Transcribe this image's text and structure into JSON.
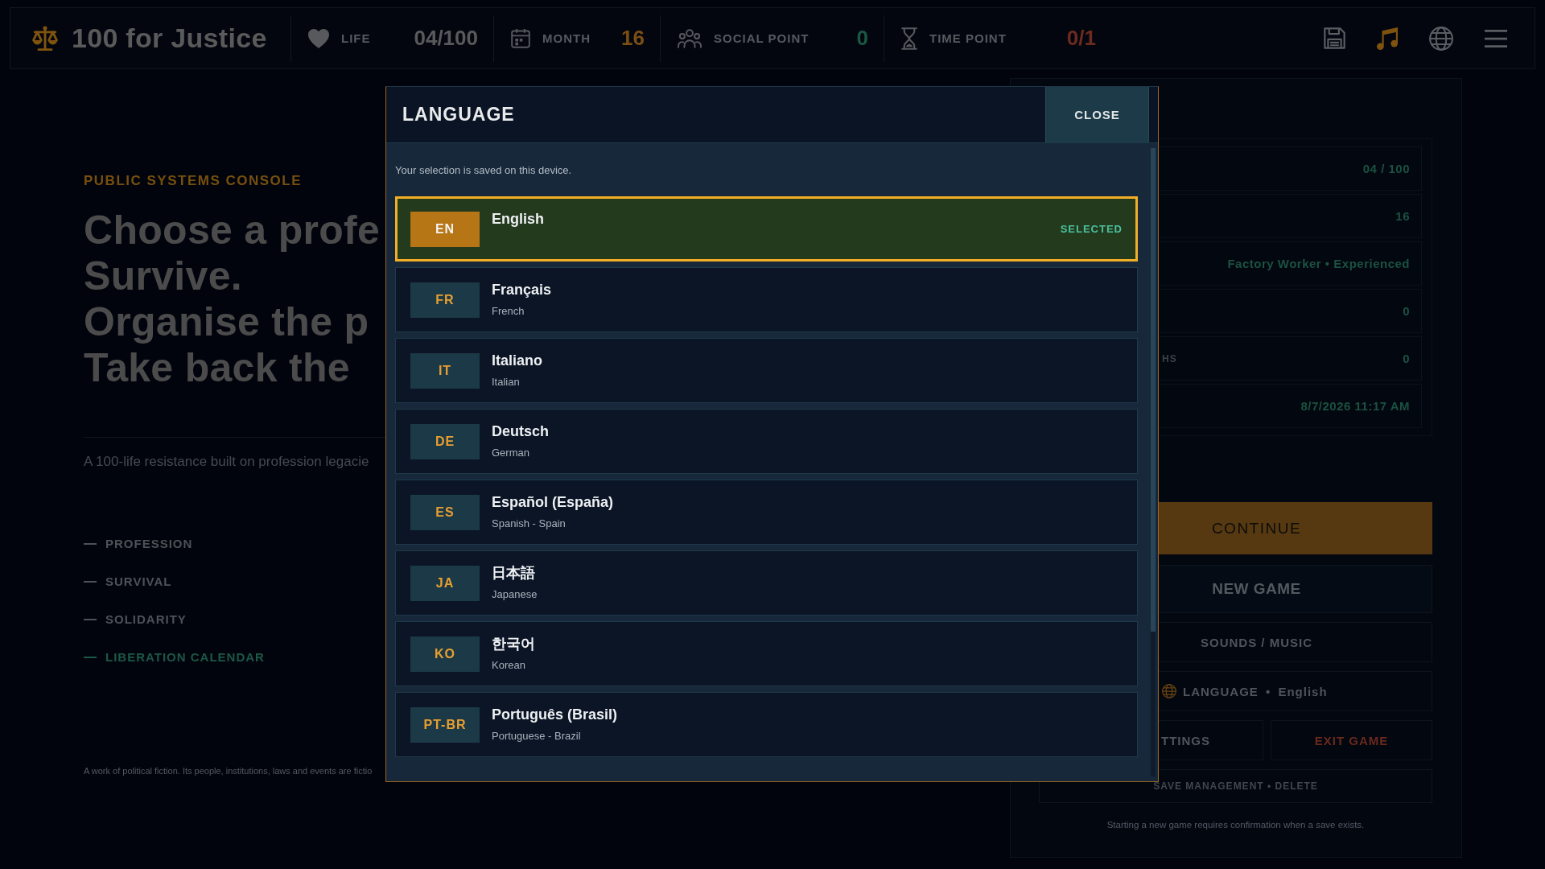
{
  "top_bar": {
    "title": "100 for Justice",
    "stats": [
      {
        "kind": "life",
        "label": "LIFE",
        "value": "04/100"
      },
      {
        "kind": "month",
        "label": "MONTH",
        "value": "16"
      },
      {
        "kind": "social",
        "label": "SOCIAL POINT",
        "value": "0"
      },
      {
        "kind": "time",
        "label": "TIME POINT",
        "value": "0/1"
      }
    ]
  },
  "intro": {
    "eyebrow": "PUBLIC SYSTEMS CONSOLE",
    "headline": [
      "Choose a profe",
      "Survive.",
      "Organise the p",
      "Take back the"
    ],
    "tagline": "A 100-life resistance built on profession legacie",
    "sections": [
      {
        "label": "PROFESSION",
        "selected": false
      },
      {
        "label": "SURVIVAL",
        "selected": false
      },
      {
        "label": "SOLIDARITY",
        "selected": false
      },
      {
        "label": "LIBERATION CALENDAR",
        "selected": true
      }
    ],
    "disclaimer": "A work of political fiction. Its people, institutions, laws and events are fictio"
  },
  "save_panel": {
    "rows": [
      {
        "value": "04 / 100"
      },
      {
        "value": "16"
      },
      {
        "value": "Factory Worker • Experienced"
      },
      {
        "value": "0"
      },
      {
        "label": "HS",
        "value": "0"
      },
      {
        "value": "8/7/2026 11:17 AM"
      }
    ],
    "buttons": [
      {
        "kind": "primary",
        "label": "CONTINUE"
      },
      {
        "kind": "secondary",
        "label": "NEW GAME"
      },
      {
        "kind": "plain",
        "label": "SOUNDS / MUSIC"
      },
      {
        "kind": "language",
        "label": "LANGUAGE • English"
      }
    ],
    "button_pair": [
      {
        "kind": "plain",
        "label": "TTINGS"
      },
      {
        "kind": "danger",
        "label": "EXIT GAME"
      }
    ],
    "save_management": "SAVE MANAGEMENT • DELETE",
    "note": "Starting a new game requires confirmation when a save exists."
  },
  "language_dialog": {
    "title": "LANGUAGE",
    "close": "CLOSE",
    "note": "Your selection is saved on this device.",
    "selected_label": "SELECTED",
    "languages": [
      {
        "code": "EN",
        "name": "English",
        "selected": true
      },
      {
        "code": "FR",
        "name": "Français",
        "english_name": "French",
        "selected": false
      },
      {
        "code": "IT",
        "name": "Italiano",
        "english_name": "Italian",
        "selected": false
      },
      {
        "code": "DE",
        "name": "Deutsch",
        "english_name": "German",
        "selected": false
      },
      {
        "code": "ES",
        "name": "Español (España)",
        "english_name": "Spanish - Spain",
        "selected": false
      },
      {
        "code": "JA",
        "name": "日本語",
        "english_name": "Japanese",
        "selected": false
      },
      {
        "code": "KO",
        "name": "한국어",
        "english_name": "Korean",
        "selected": false
      },
      {
        "code": "PT-BR",
        "name": "Português (Brasil)",
        "english_name": "Portuguese - Brazil",
        "selected": false
      }
    ]
  }
}
